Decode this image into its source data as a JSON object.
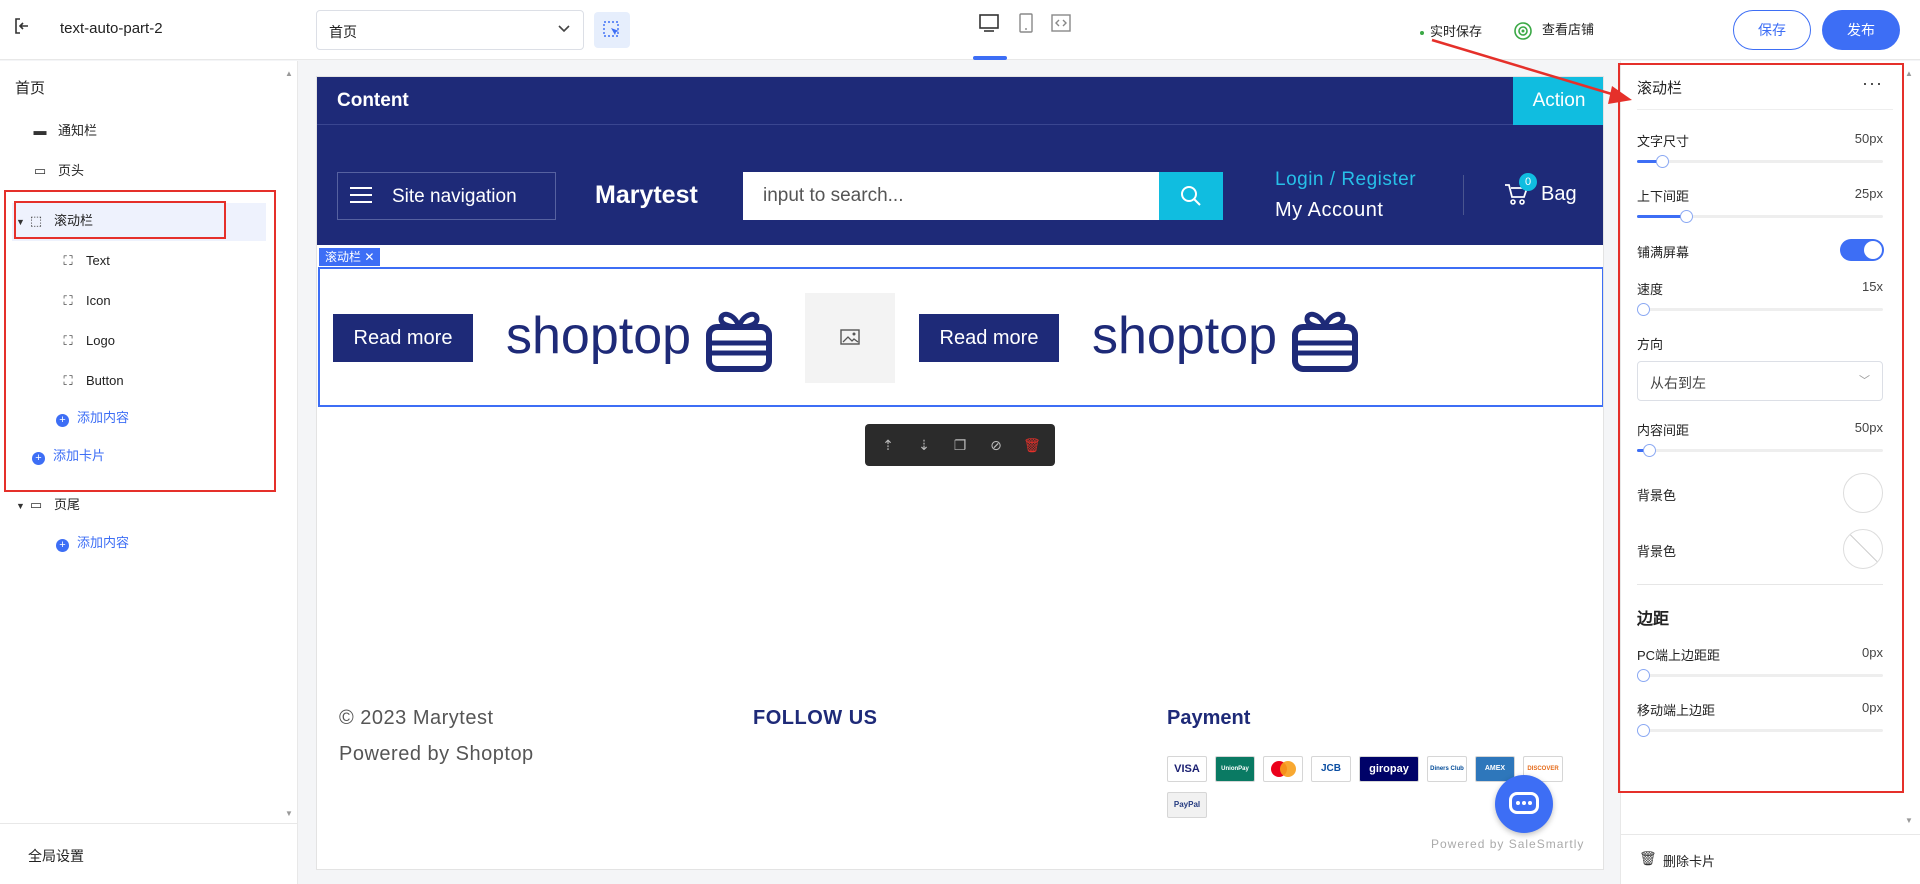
{
  "topbar": {
    "project_name": "text-auto-part-2",
    "page_select_value": "首页",
    "autosave_label": "实时保存",
    "view_store_label": "查看店铺",
    "save_label": "保存",
    "publish_label": "发布"
  },
  "left_panel": {
    "title": "首页",
    "items": [
      {
        "label": "通知栏"
      },
      {
        "label": "页头"
      },
      {
        "label": "滚动栏"
      },
      {
        "label": "Text"
      },
      {
        "label": "Icon"
      },
      {
        "label": "Logo"
      },
      {
        "label": "Button"
      },
      {
        "label": "页尾"
      }
    ],
    "add_content_label": "添加内容",
    "add_card_label": "添加卡片",
    "footer_add_content_label": "添加内容",
    "global_settings_label": "全局设置"
  },
  "site": {
    "top_bar_text": "Content",
    "action_label": "Action",
    "nav_label": "Site navigation",
    "brand": "Marytest",
    "search_placeholder": "input to search...",
    "login_label": "Login / Register",
    "account_label": "My Account",
    "cart_count": "0",
    "bag_label": "Bag",
    "selected_tag": "滚动栏",
    "marquee": {
      "button_label": "Read more",
      "text": "shoptop"
    },
    "footer": {
      "copyright": "© 2023 Marytest",
      "powered": "Powered by Shoptop",
      "follow_title": "FOLLOW US",
      "payment_title": "Payment",
      "payment_methods": [
        "VISA",
        "UnionPay",
        "Mastercard",
        "JCB",
        "giropay",
        "Diners Club",
        "AMEX",
        "DISCOVER",
        "PayPal"
      ],
      "chat_powered": "Powered by SaleSmartly"
    }
  },
  "right_panel": {
    "title": "滚动栏",
    "font_size_label": "文字尺寸",
    "font_size_value": "50px",
    "font_size_fraction": 0.1,
    "vpadding_label": "上下间距",
    "vpadding_value": "25px",
    "vpadding_fraction": 0.2,
    "fullscreen_label": "铺满屏幕",
    "fullscreen_on": true,
    "speed_label": "速度",
    "speed_value": "15x",
    "speed_fraction": 0.0,
    "direction_label": "方向",
    "direction_value": "从右到左",
    "gap_label": "内容间距",
    "gap_value": "50px",
    "gap_fraction": 0.05,
    "bg_color_label_1": "背景色",
    "bg_color_label_2": "背景色",
    "margin_section": "边距",
    "pc_top_margin_label": "PC端上边距距",
    "pc_top_margin_value": "0px",
    "mobile_top_margin_label": "移动端上边距",
    "mobile_top_margin_value": "0px",
    "delete_card_label": "删除卡片"
  },
  "colors": {
    "accent": "#3d6ef5",
    "site_primary": "#1e2a78",
    "site_cyan": "#10bde0",
    "annotation_red": "#e5302a"
  }
}
